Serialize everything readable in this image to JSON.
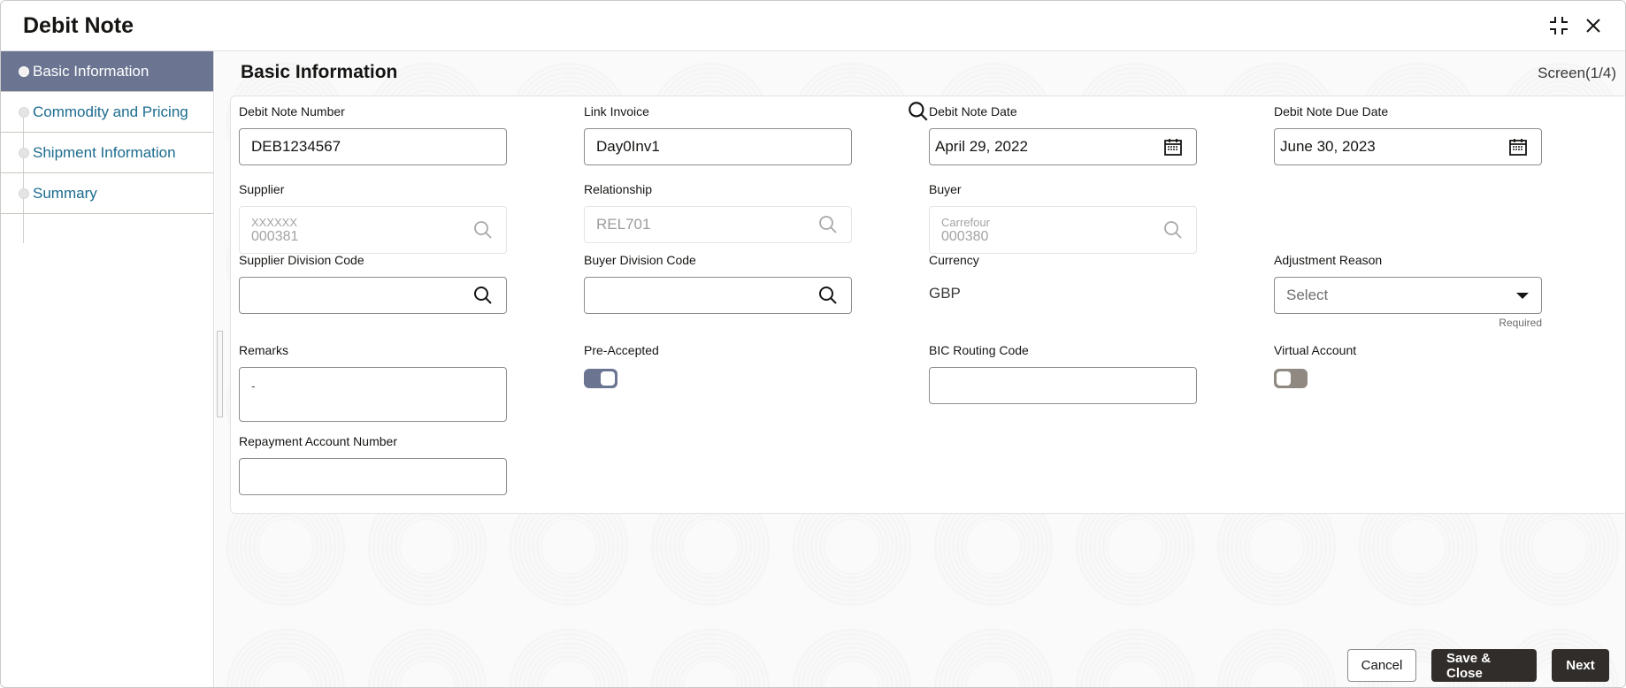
{
  "dialog": {
    "title": "Debit Note",
    "icons": {
      "collapse": "collapse-icon",
      "close": "close-icon"
    }
  },
  "sidebar": {
    "items": [
      {
        "label": "Basic Information",
        "active": true
      },
      {
        "label": "Commodity and Pricing",
        "active": false
      },
      {
        "label": "Shipment Information",
        "active": false
      },
      {
        "label": "Summary",
        "active": false
      }
    ]
  },
  "main": {
    "section_title": "Basic Information",
    "screen_indicator": "Screen(1/4)"
  },
  "form": {
    "debit_note_number": {
      "label": "Debit Note Number",
      "value": "DEB1234567"
    },
    "link_invoice": {
      "label": "Link Invoice",
      "value": "Day0Inv1"
    },
    "debit_note_date": {
      "label": "Debit Note Date",
      "value": "April 29, 2022"
    },
    "debit_note_due_date": {
      "label": "Debit Note Due Date",
      "value": "June 30, 2023"
    },
    "supplier": {
      "label": "Supplier",
      "name": "XXXXXX",
      "code": "000381"
    },
    "relationship": {
      "label": "Relationship",
      "value": "REL701"
    },
    "buyer": {
      "label": "Buyer",
      "name": "Carrefour",
      "code": "000380"
    },
    "supplier_division_code": {
      "label": "Supplier Division Code",
      "value": ""
    },
    "buyer_division_code": {
      "label": "Buyer Division Code",
      "value": ""
    },
    "currency": {
      "label": "Currency",
      "value": "GBP"
    },
    "adjustment_reason": {
      "label": "Adjustment Reason",
      "placeholder": "Select",
      "helper": "Required"
    },
    "remarks": {
      "label": "Remarks",
      "value": "-"
    },
    "pre_accepted": {
      "label": "Pre-Accepted",
      "checked": true
    },
    "bic_routing_code": {
      "label": "BIC Routing Code",
      "value": ""
    },
    "virtual_account": {
      "label": "Virtual Account",
      "checked": false
    },
    "repayment_account_number": {
      "label": "Repayment Account Number",
      "value": ""
    }
  },
  "footer": {
    "cancel_label": "Cancel",
    "save_close_label": "Save & Close",
    "next_label": "Next"
  },
  "colors": {
    "accent": "#6b7592",
    "link": "#1c6b8f",
    "primary_button": "#312d2a",
    "toggle_off": "#8f8982"
  }
}
